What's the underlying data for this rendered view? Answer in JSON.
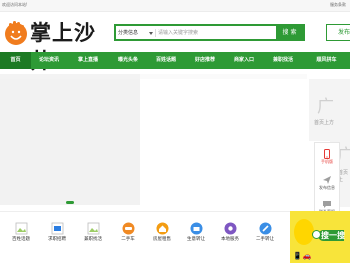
{
  "topbar": {
    "welcome": "欢迎访问本站!",
    "right_links": "服务条款"
  },
  "logo": {
    "title": "掌上沙井"
  },
  "search": {
    "category": "分类信息",
    "placeholder": "请输入关键字搜索",
    "button": "搜 索"
  },
  "publish_button": "发布",
  "nav": {
    "items": [
      "首页",
      "论坛资讯",
      "掌上直播",
      "曝光头条",
      "百姓话题",
      "好店推荐",
      "商家入口",
      "兼职找活",
      "顺风拼车"
    ],
    "active_index": 0
  },
  "right_ad": {
    "big": "广",
    "sub": "首页上方"
  },
  "right_ad2": {
    "big": "广",
    "sub": "首页上"
  },
  "float_bar": {
    "items": [
      {
        "label": "手机版",
        "icon": "phone-icon"
      },
      {
        "label": "发布信息",
        "icon": "send-icon"
      },
      {
        "label": "联系客服",
        "icon": "chat-icon"
      }
    ]
  },
  "services": [
    {
      "label": "百姓话题",
      "icon": "image-icon",
      "color": "#bdbdbd"
    },
    {
      "label": "求职招聘",
      "icon": "job-icon",
      "color": "#2b7de1"
    },
    {
      "label": "兼职找活",
      "icon": "image-icon",
      "color": "#bdbdbd"
    },
    {
      "label": "二手车",
      "icon": "car-icon",
      "color": "#f08a24"
    },
    {
      "label": "房屋租售",
      "icon": "house-icon",
      "color": "#f39c12"
    },
    {
      "label": "生意转让",
      "icon": "shop-icon",
      "color": "#3a8ee6"
    },
    {
      "label": "本地服务",
      "icon": "service-icon",
      "color": "#7e57c2"
    },
    {
      "label": "二手转让",
      "icon": "link-icon",
      "color": "#3a8ee6"
    }
  ],
  "promo": {
    "search_label": "搜一搜"
  },
  "colors": {
    "brand": "#2e9a35",
    "nav_active": "#1d7a24",
    "promo_bg": "#f8e43a"
  }
}
